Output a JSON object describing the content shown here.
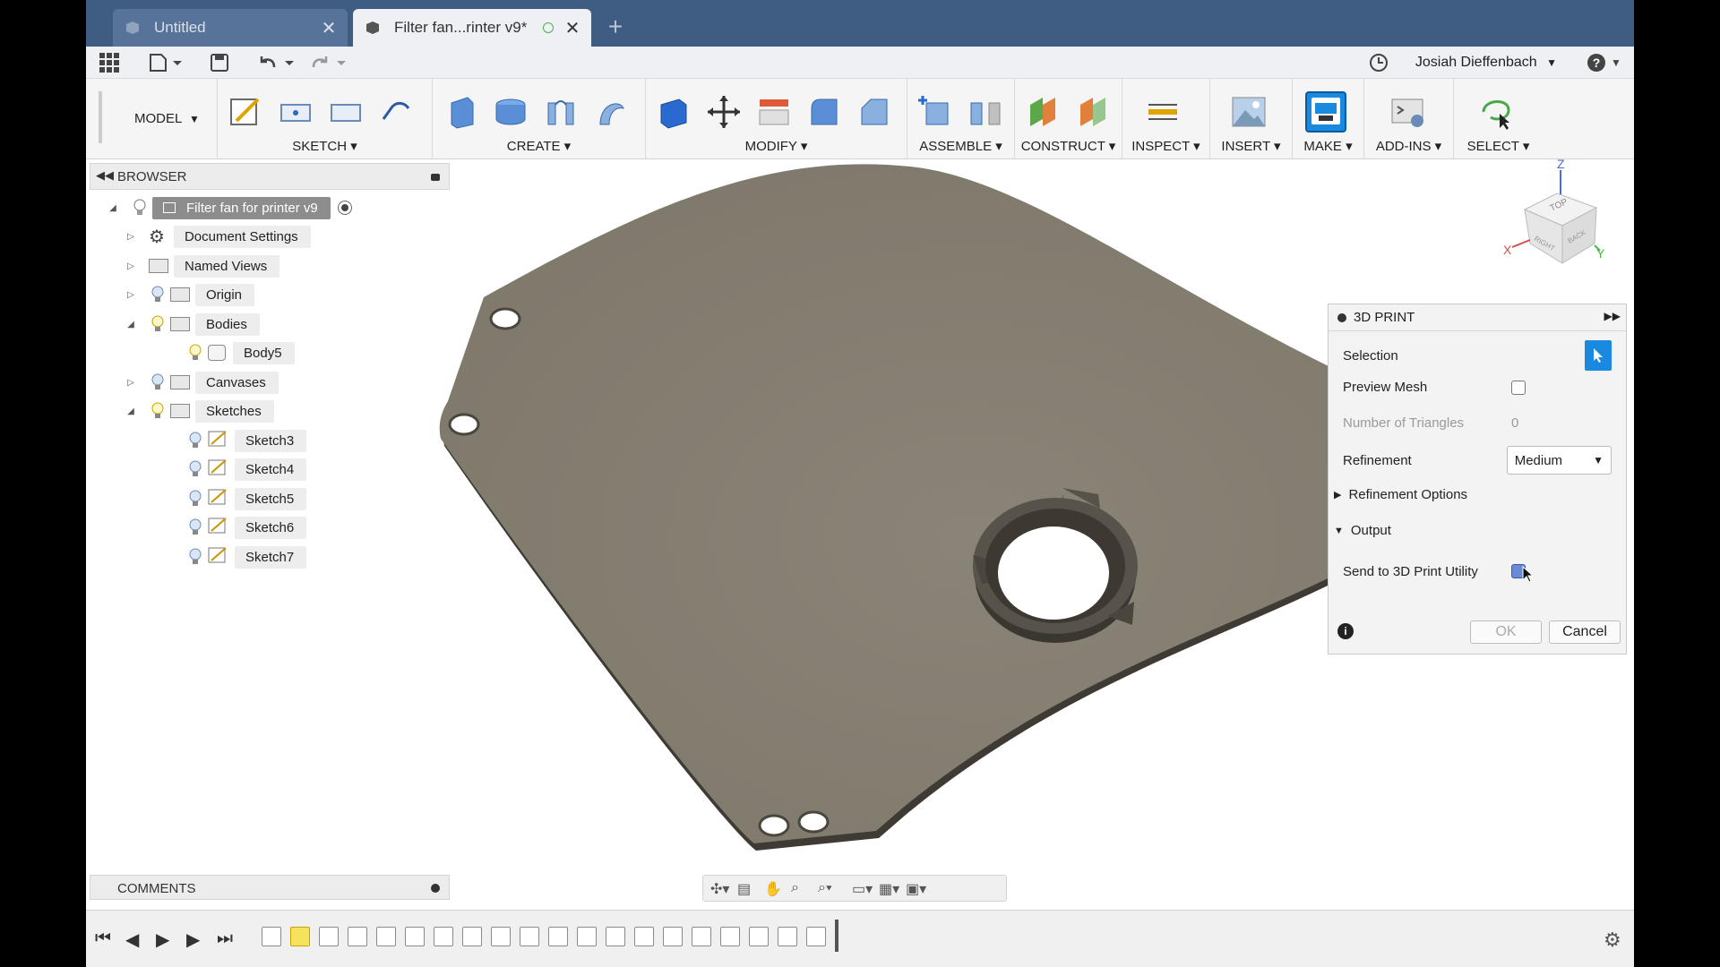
{
  "tabs": [
    {
      "label": "Untitled",
      "close": "✕"
    },
    {
      "label": "Filter fan...rinter v9*",
      "close": "✕"
    }
  ],
  "new_tab": "+",
  "user": {
    "name": "Josiah Dieffenbach",
    "help": "?"
  },
  "ribbon": {
    "workspace": "MODEL",
    "groups": [
      "SKETCH",
      "CREATE",
      "MODIFY",
      "ASSEMBLE",
      "CONSTRUCT",
      "INSPECT",
      "INSERT",
      "MAKE",
      "ADD-INS",
      "SELECT"
    ]
  },
  "browser": {
    "title": "BROWSER",
    "root": "Filter fan for printer v9",
    "items": [
      "Document Settings",
      "Named Views",
      "Origin",
      "Bodies",
      "Body5",
      "Canvases",
      "Sketches",
      "Sketch3",
      "Sketch4",
      "Sketch5",
      "Sketch6",
      "Sketch7"
    ]
  },
  "viewcube": {
    "top": "TOP",
    "front": "RIGHT",
    "back": "BACK",
    "x": "X",
    "y": "Y",
    "z": "Z"
  },
  "print_panel": {
    "title": "3D PRINT",
    "selection_label": "Selection",
    "preview_mesh_label": "Preview Mesh",
    "triangles_label": "Number of Triangles",
    "triangles_value": "0",
    "refinement_label": "Refinement",
    "refinement_value": "Medium",
    "refinement_options_label": "Refinement Options",
    "output_label": "Output",
    "send_label": "Send to 3D Print Utility",
    "ok_label": "OK",
    "cancel_label": "Cancel"
  },
  "comments": {
    "title": "COMMENTS"
  },
  "colors": {
    "accent": "#1a8ae0",
    "tabbar": "#3f5d82",
    "plate": "#8c8578"
  }
}
